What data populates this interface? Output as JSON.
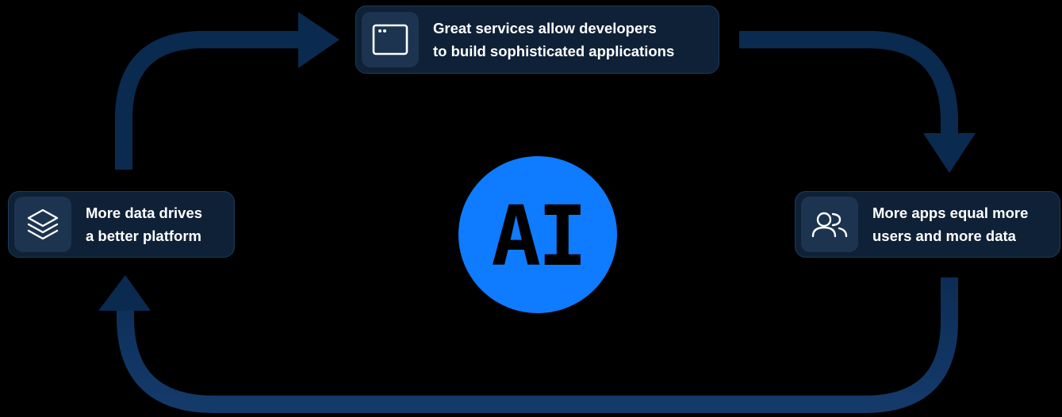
{
  "diagram": {
    "nodes": {
      "top": {
        "line1": "Great services allow developers",
        "line2": "to build sophisticated applications",
        "icon": "app-window-icon"
      },
      "right": {
        "line1": "More apps equal more",
        "line2": "users and more data",
        "icon": "users-icon"
      },
      "left": {
        "line1": "More data drives",
        "line2": "a better platform",
        "icon": "layers-icon"
      }
    },
    "center": {
      "label": "AI"
    },
    "colors": {
      "background": "#000000",
      "arrow": "#0b2a4f",
      "node_fill": "#0f2137",
      "node_icon_fill": "#1c3450",
      "center_fill": "#0f7bff"
    }
  }
}
